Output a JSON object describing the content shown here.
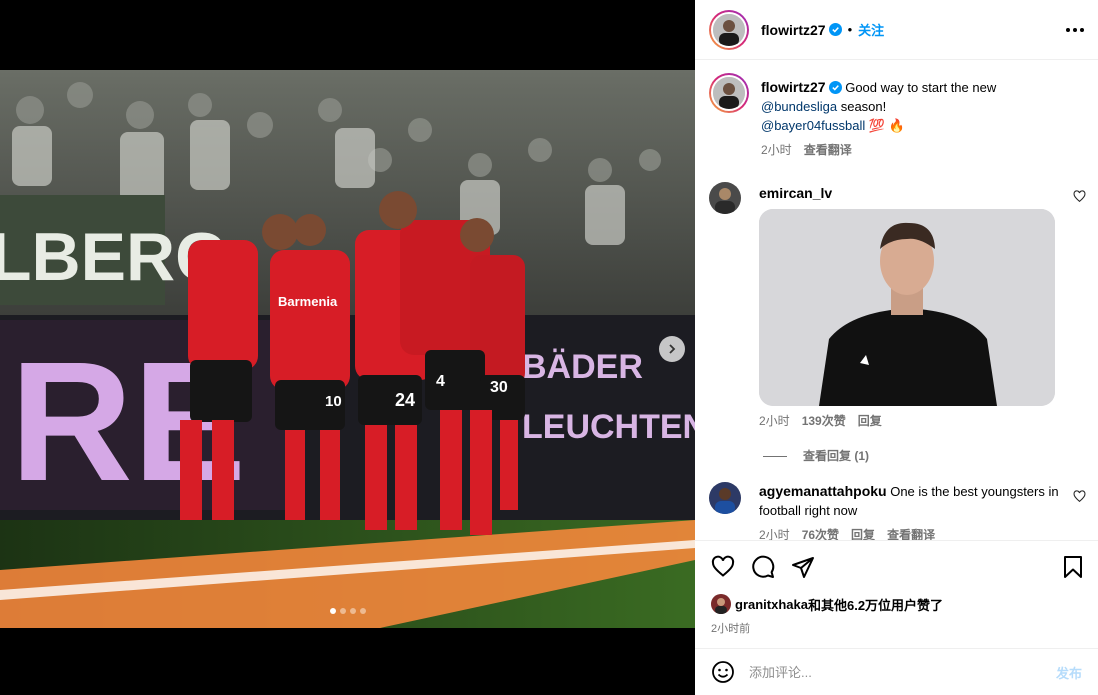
{
  "post": {
    "author": "flowirtz27",
    "follow_label": "关注",
    "separator": "•",
    "caption": {
      "text_1": "Good way to start the new",
      "mention_1": "@bundesliga",
      "text_2": "season!",
      "mention_2": "@bayer04fussball",
      "emoji": "💯 🔥"
    },
    "time": "2小时",
    "translate_label": "查看翻译"
  },
  "media": {
    "photo_text": {
      "sponsor": "Barmenia",
      "banner_left": "LBERG",
      "board_big": "RE",
      "board_right_1": "BÄDER",
      "board_right_2": "LEUCHTEN",
      "numbers": [
        "10",
        "24",
        "4",
        "30"
      ]
    },
    "carousel": {
      "count": 4,
      "active": 0
    }
  },
  "comments": [
    {
      "user": "emircan_lv",
      "time": "2小时",
      "likes": "139次赞",
      "reply_label": "回复",
      "view_replies": "查看回复 (1)"
    },
    {
      "user": "agyemanattahpoku",
      "text": "One is the best youngsters in football right now",
      "time": "2小时",
      "likes": "76次赞",
      "reply_label": "回复",
      "translate_label": "查看翻译"
    }
  ],
  "likes_summary": {
    "user": "granitxhaka",
    "rest": "和其他6.2万位用户赞了"
  },
  "post_time": "2小时前",
  "composer": {
    "placeholder": "添加评论...",
    "post_label": "发布"
  },
  "colors": {
    "accent": "#0095f6",
    "verified": "#0095f6",
    "kit_red": "#d71d26"
  }
}
